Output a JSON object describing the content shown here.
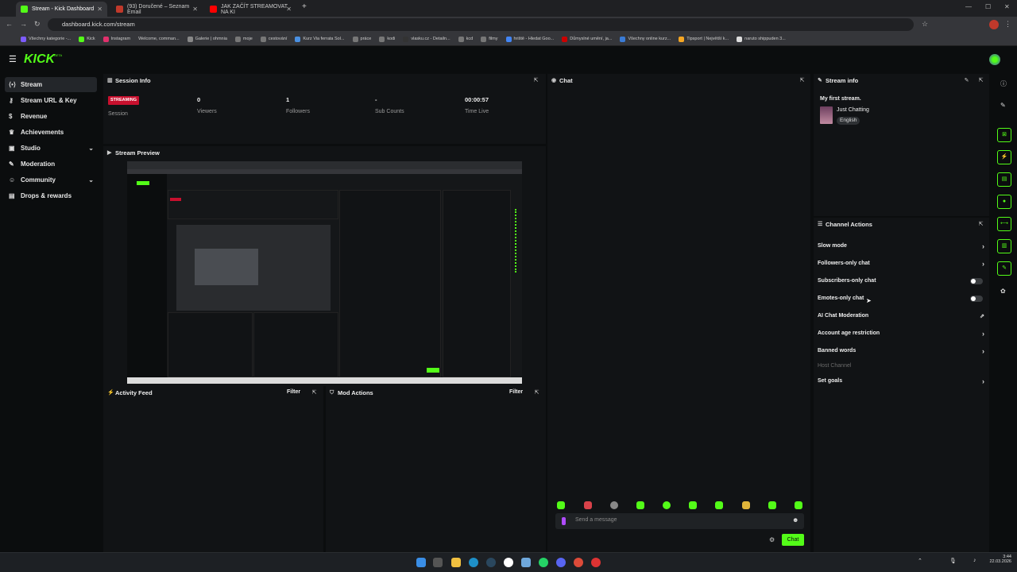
{
  "browser": {
    "tabs": [
      {
        "title": "Stream - Kick Dashboard",
        "active": true,
        "icon_color": "#53fc18"
      },
      {
        "title": "(93) Doručené – Seznam Email",
        "active": false,
        "icon_color": "#c0392b"
      },
      {
        "title": "JAK ZAČÍT STREAMOVAT NA KI",
        "active": false,
        "icon_color": "#ff0000"
      }
    ],
    "new_tab_label": "+",
    "url": "dashboard.kick.com/stream",
    "bookmarks": [
      "Všechny kategorie -...",
      "Kick",
      "Instagram",
      "Welcome, comman...",
      "Galerie | ohmnia",
      "moje",
      "cestování",
      "Kurz Via ferrata Sol...",
      "práce",
      "kodi",
      "vlasku.cz - Detailn...",
      "kcd",
      "filmy",
      "hriště - Hledat Goo...",
      "Důmyslné umění, ja...",
      "Všechny online kurz...",
      "Tipsport | Největší k...",
      "naruto shippuden 3..."
    ]
  },
  "app": {
    "logo": "KICK",
    "logo_badge": "BETA",
    "accent": "#53fc18"
  },
  "sidebar": {
    "items": [
      {
        "label": "Stream",
        "icon": "stream-icon",
        "active": true
      },
      {
        "label": "Stream URL & Key",
        "icon": "key-icon"
      },
      {
        "label": "Revenue",
        "icon": "dollar-icon"
      },
      {
        "label": "Achievements",
        "icon": "trophy-icon"
      },
      {
        "label": "Studio",
        "icon": "studio-icon",
        "chevron": true
      },
      {
        "label": "Moderation",
        "icon": "wrench-icon"
      },
      {
        "label": "Community",
        "icon": "people-icon",
        "chevron": true
      },
      {
        "label": "Drops & rewards",
        "icon": "gift-icon"
      }
    ]
  },
  "session": {
    "title": "Session Info",
    "status_badge": "STREAMING",
    "status_label": "Session",
    "stats": [
      {
        "value": "0",
        "label": "Viewers"
      },
      {
        "value": "1",
        "label": "Followers"
      },
      {
        "value": "-",
        "label": "Sub Counts"
      },
      {
        "value": "00:00:57",
        "label": "Time Live"
      }
    ]
  },
  "preview": {
    "title": "Stream Preview"
  },
  "activity": {
    "title": "Activity Feed",
    "filter": "Filter"
  },
  "mod_actions": {
    "title": "Mod Actions",
    "filter": "Filter"
  },
  "chat": {
    "title": "Chat",
    "placeholder": "Send a message",
    "send_label": "Chat"
  },
  "stream_info": {
    "title": "Stream info",
    "stream_title": "My first stream.",
    "category": "Just Chatting",
    "language": "English"
  },
  "channel_actions": {
    "title": "Channel Actions",
    "rows": [
      {
        "label": "Slow mode",
        "control": "arrow"
      },
      {
        "label": "Followers-only chat",
        "control": "arrow"
      },
      {
        "label": "Subscribers-only chat",
        "control": "toggle"
      },
      {
        "label": "Emotes-only chat",
        "control": "toggle"
      },
      {
        "label": "AI Chat Moderation",
        "control": "external"
      },
      {
        "label": "Account age restriction",
        "control": "arrow"
      },
      {
        "label": "Banned words",
        "control": "arrow"
      },
      {
        "label": "Host Channel",
        "control": "none",
        "disabled": true
      },
      {
        "label": "Set goals",
        "control": "arrow"
      }
    ]
  },
  "taskbar": {
    "time": "3:44",
    "date": "22.03.2026"
  }
}
